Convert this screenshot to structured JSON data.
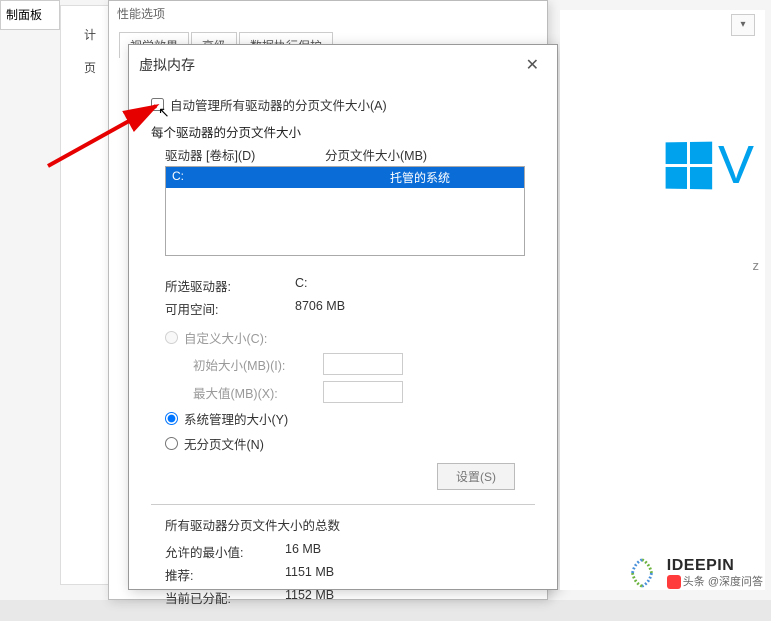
{
  "bg_panel_label": "制面板",
  "side": {
    "item1": "计",
    "item2": "页"
  },
  "bg_dialog": {
    "header": "性能选项",
    "tabs": [
      "视觉效果",
      "高级",
      "数据执行保护"
    ]
  },
  "dialog": {
    "title": "虚拟内存",
    "auto_manage": "自动管理所有驱动器的分页文件大小(A)",
    "section": "每个驱动器的分页文件大小",
    "col_drive": "驱动器 [卷标](D)",
    "col_size": "分页文件大小(MB)",
    "drive_row": {
      "drive": "C:",
      "status": "托管的系统"
    },
    "selected_drive_label": "所选驱动器:",
    "selected_drive_value": "C:",
    "avail_label": "可用空间:",
    "avail_value": "8706 MB",
    "custom_size": "自定义大小(C):",
    "initial_label": "初始大小(MB)(I):",
    "max_label": "最大值(MB)(X):",
    "system_managed": "系统管理的大小(Y)",
    "no_paging": "无分页文件(N)",
    "set_btn": "设置(S)",
    "totals_title": "所有驱动器分页文件大小的总数",
    "min_label": "允许的最小值:",
    "min_value": "16 MB",
    "rec_label": "推荐:",
    "rec_value": "1151 MB",
    "cur_label": "当前已分配:",
    "cur_value": "1152 MB"
  },
  "right": {
    "z": "z",
    "win_v": "V"
  },
  "watermark": {
    "brand": "IDEEPIN",
    "sub": "头条 @深度问答"
  }
}
